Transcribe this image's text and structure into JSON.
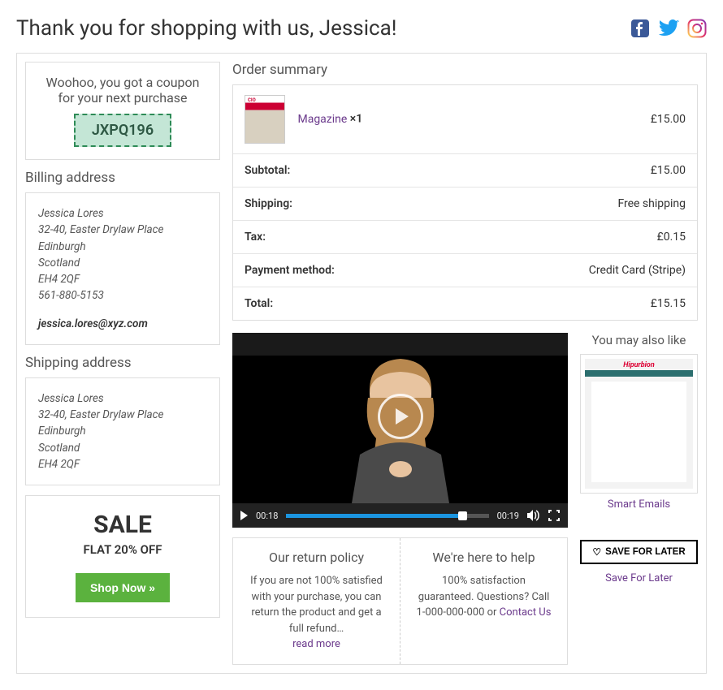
{
  "header": {
    "title": "Thank you for shopping with us, Jessica!"
  },
  "social": {
    "facebook": "facebook-icon",
    "twitter": "twitter-icon",
    "instagram": "instagram-icon"
  },
  "coupon": {
    "message": "Woohoo, you got a coupon for your next purchase",
    "code": "JXPQ196"
  },
  "billing": {
    "heading": "Billing address",
    "name": "Jessica Lores",
    "line1": "32-40, Easter Drylaw Place",
    "city": "Edinburgh",
    "region": "Scotland",
    "postcode": "EH4 2QF",
    "phone": "561-880-5153",
    "email": "jessica.lores@xyz.com"
  },
  "shipping": {
    "heading": "Shipping address",
    "name": "Jessica Lores",
    "line1": "32-40, Easter Drylaw Place",
    "city": "Edinburgh",
    "region": "Scotland",
    "postcode": "EH4 2QF"
  },
  "sale": {
    "title": "SALE",
    "subtitle": "FLAT 20% OFF",
    "button": "Shop Now »"
  },
  "order": {
    "heading": "Order summary",
    "item": {
      "name": "Magazine",
      "qty": "×1",
      "price": "£15.00"
    },
    "rows": {
      "subtotal_label": "Subtotal:",
      "subtotal_value": "£15.00",
      "shipping_label": "Shipping:",
      "shipping_value": "Free shipping",
      "tax_label": "Tax:",
      "tax_value": "£0.15",
      "payment_label": "Payment method:",
      "payment_value": "Credit Card (Stripe)",
      "total_label": "Total:",
      "total_value": "£15.15"
    }
  },
  "video": {
    "current_time": "00:18",
    "duration": "00:19"
  },
  "info": {
    "return_title": "Our return policy",
    "return_text": "If you are not 100% satisfied with your purchase, you can return the product and get a full refund…",
    "read_more": "read more",
    "help_title": "We're here to help",
    "help_text": "100% satisfaction guaranteed. Questions? Call 1-000-000-000 or ",
    "contact": "Contact Us"
  },
  "aside": {
    "heading": "You may also like",
    "rec_label": "Smart Emails",
    "save_button": "SAVE FOR LATER",
    "save_label": "Save For Later"
  }
}
